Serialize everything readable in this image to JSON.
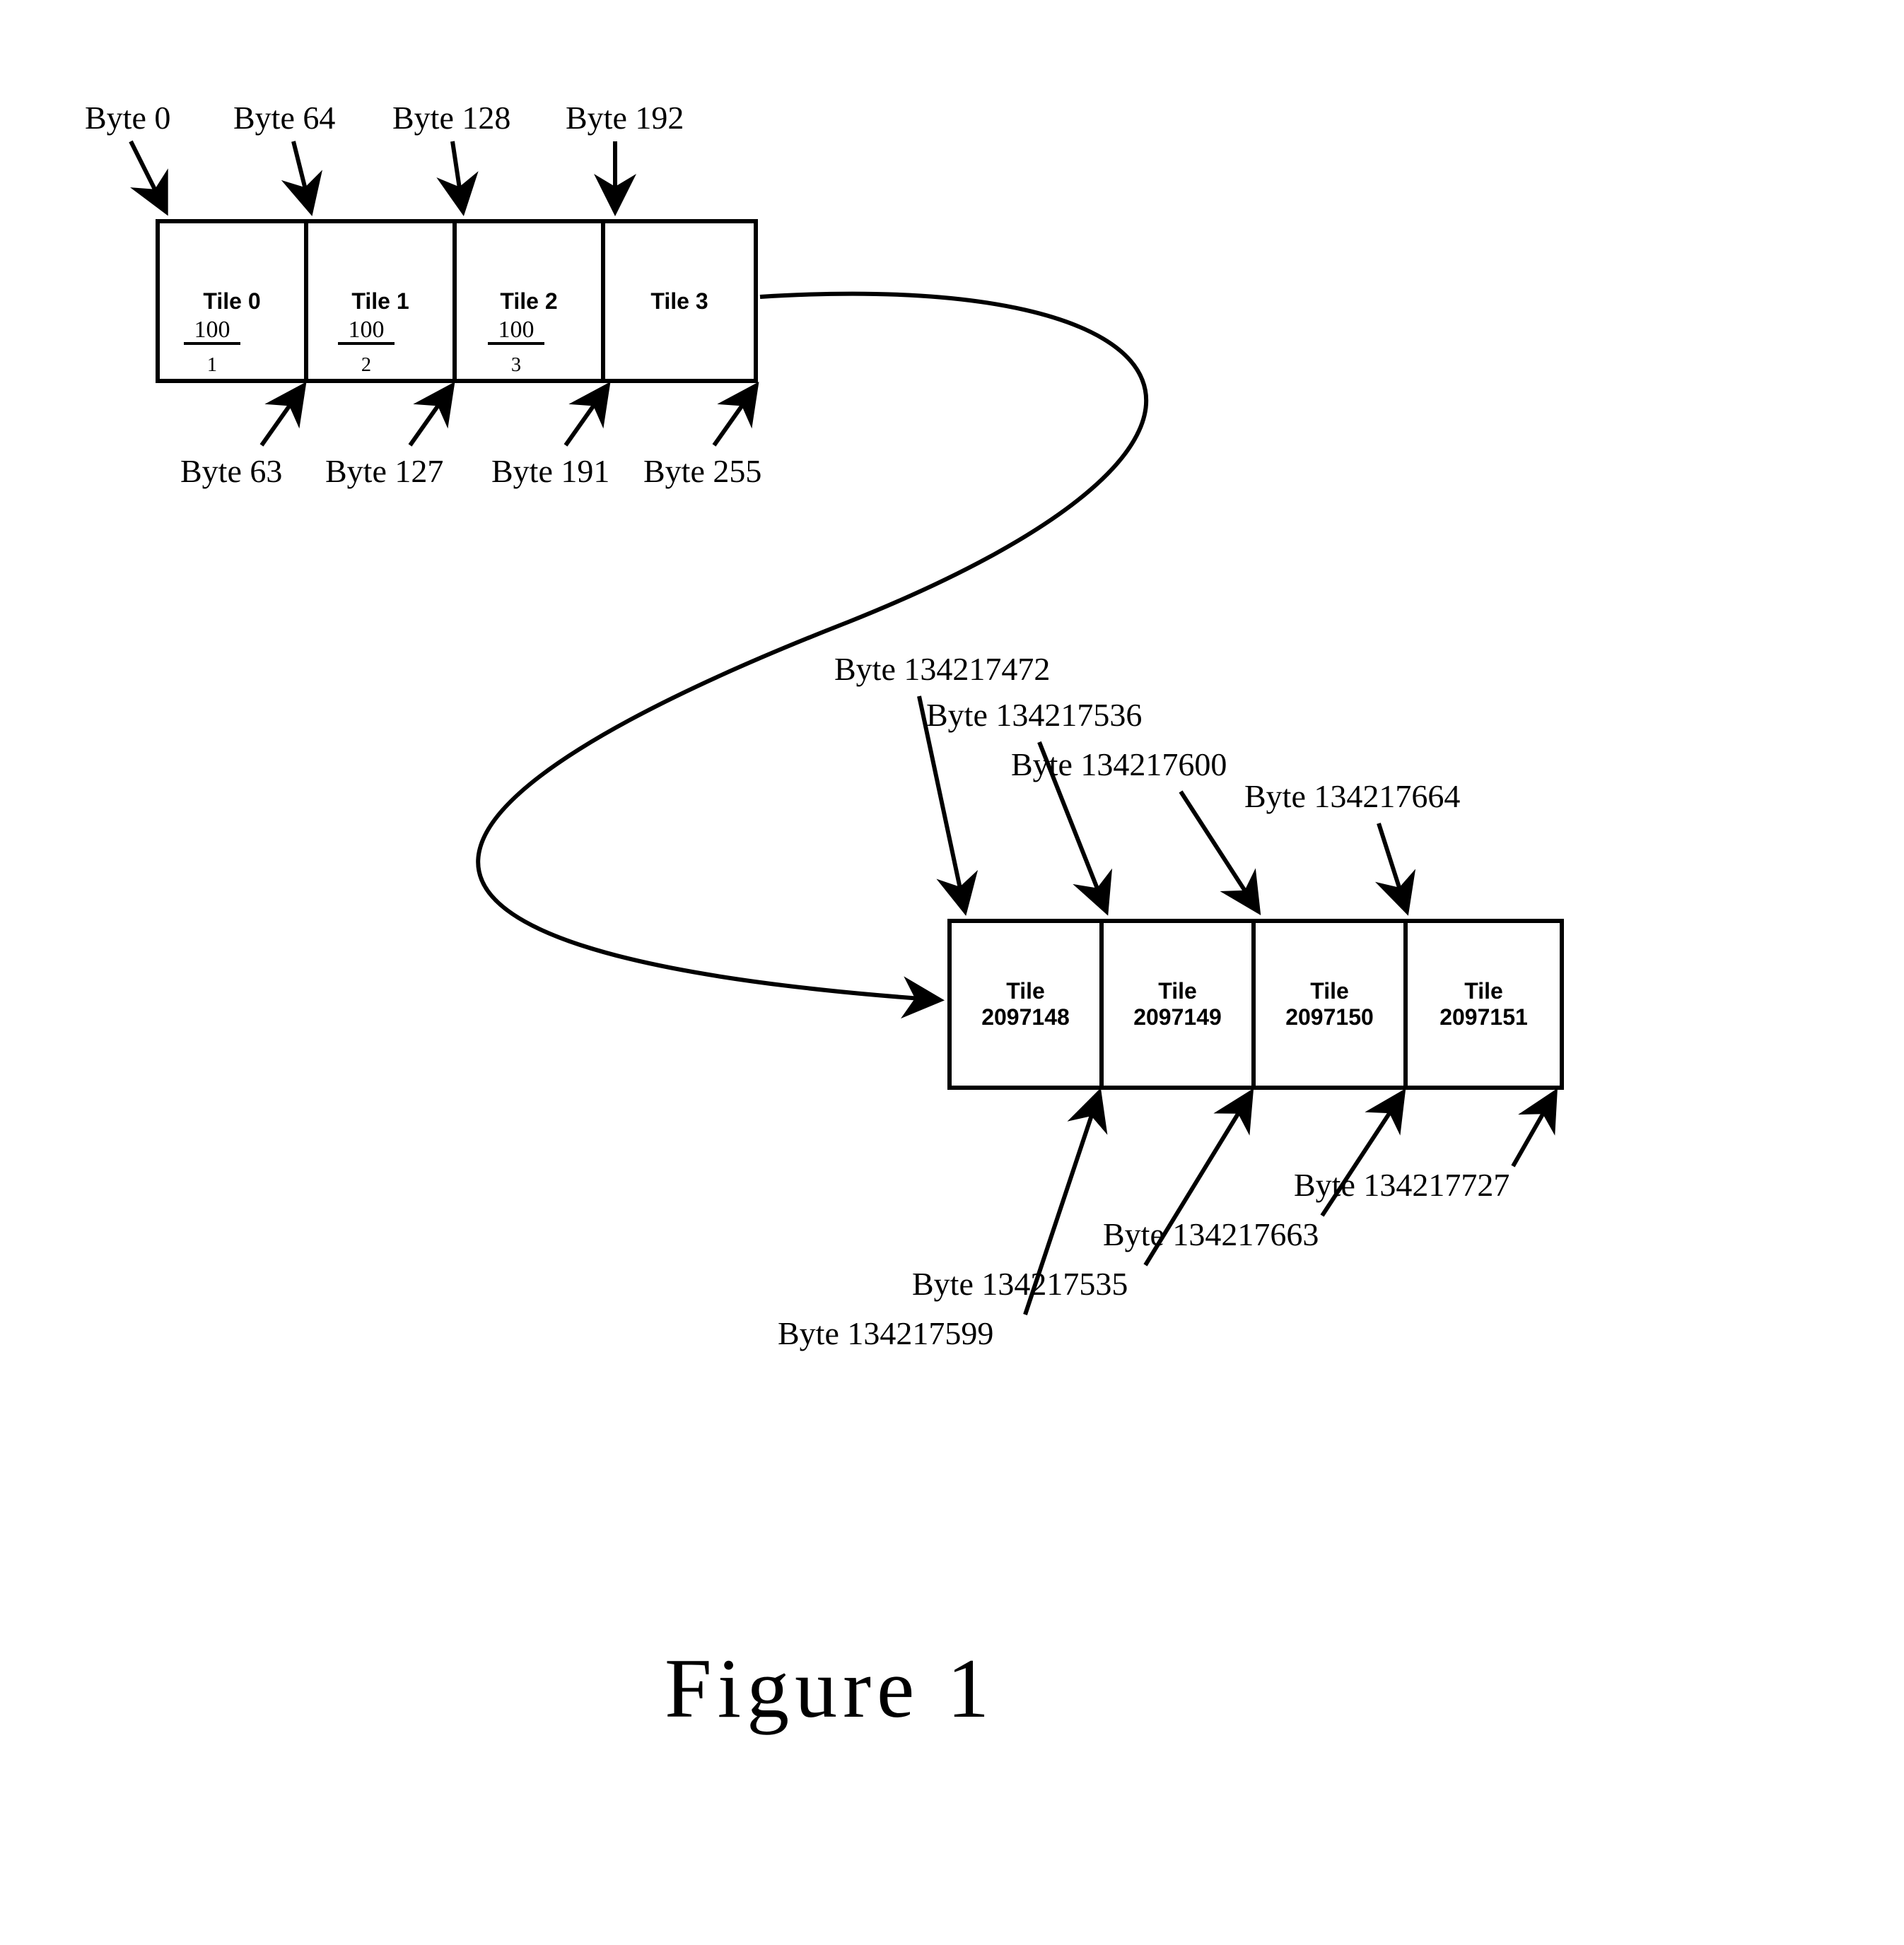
{
  "top_labels": {
    "byte0": "Byte 0",
    "byte64": "Byte 64",
    "byte128": "Byte 128",
    "byte192": "Byte 192"
  },
  "top_tiles": [
    {
      "label": "Tile 0"
    },
    {
      "label": "Tile 1"
    },
    {
      "label": "Tile 2"
    },
    {
      "label": "Tile 3"
    }
  ],
  "top_refs": {
    "r1": "100",
    "r1_sub": "1",
    "r2": "100",
    "r2_sub": "2",
    "r3": "100",
    "r3_sub": "3"
  },
  "top_bottom_labels": {
    "byte63": "Byte 63",
    "byte127": "Byte 127",
    "byte191": "Byte 191",
    "byte255": "Byte 255"
  },
  "bottom_top_labels": {
    "b1": "Byte 134217472",
    "b2": "Byte 134217536",
    "b3": "Byte 134217600",
    "b4": "Byte 134217664"
  },
  "bottom_tiles": [
    {
      "top": "Tile",
      "bot": "2097148"
    },
    {
      "top": "Tile",
      "bot": "2097149"
    },
    {
      "top": "Tile",
      "bot": "2097150"
    },
    {
      "top": "Tile",
      "bot": "2097151"
    }
  ],
  "bottom_bottom_labels": {
    "b1": "Byte 134217599",
    "b2": "Byte 134217535",
    "b3": "Byte 134217663",
    "b4": "Byte 134217727"
  },
  "caption": "Figure 1"
}
